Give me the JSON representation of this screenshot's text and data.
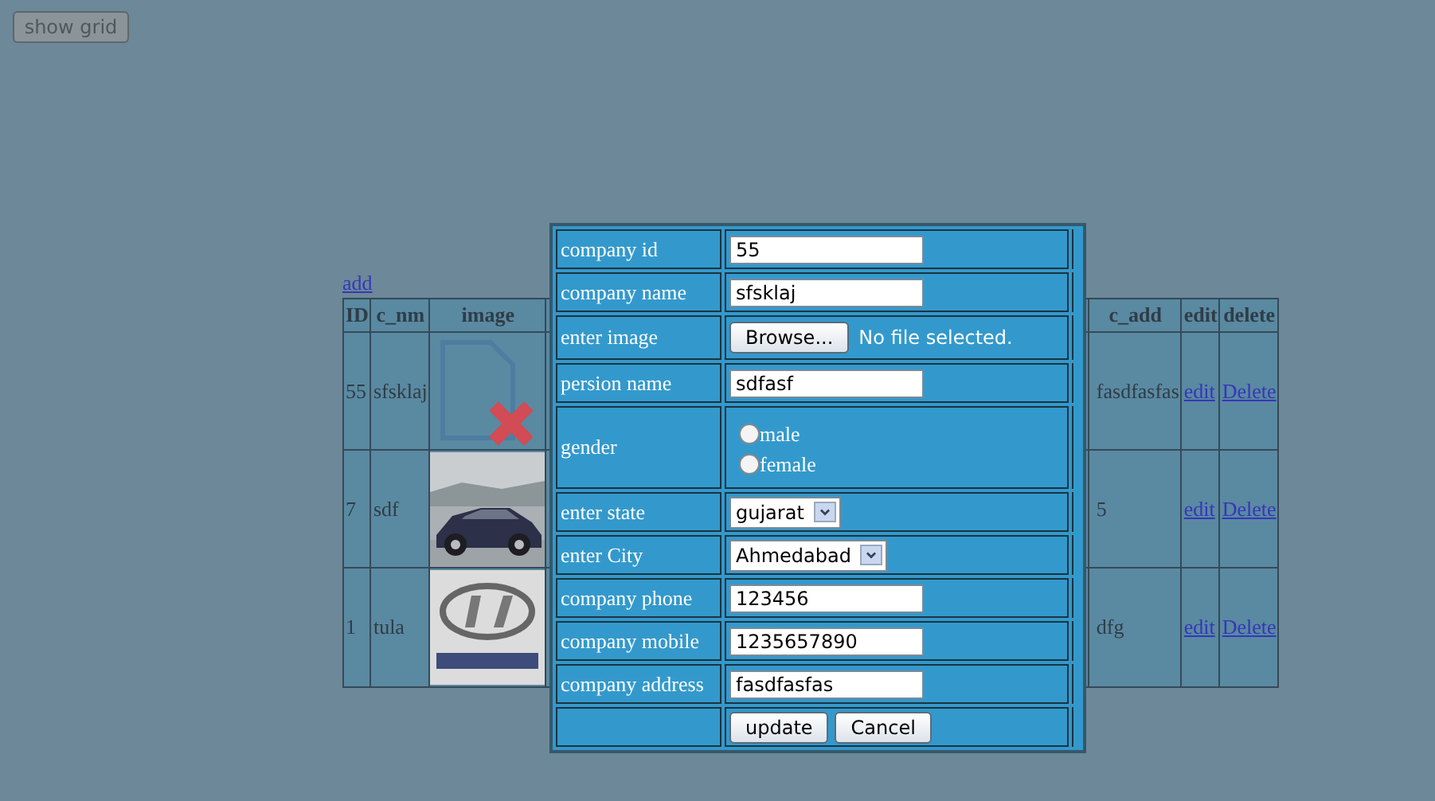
{
  "toolbar": {
    "show_grid_button": "show grid"
  },
  "grid": {
    "add_link": "add",
    "columns": [
      "ID",
      "c_nm",
      "image",
      "c_add",
      "edit",
      "delete"
    ],
    "rows": [
      {
        "id": "55",
        "c_nm": "sfsklaj",
        "image": {
          "kind": "broken"
        },
        "c_add": "fasdfasfas",
        "edit": "edit",
        "delete": "Delete"
      },
      {
        "id": "7",
        "c_nm": "sdf",
        "c_add": "5",
        "edit": "edit",
        "delete": "Delete"
      },
      {
        "id": "1",
        "c_nm": "tula",
        "image": {
          "kind": "logo"
        },
        "c_add": "dfg",
        "edit": "edit",
        "delete": "Delete"
      }
    ]
  },
  "dialog": {
    "fields": [
      {
        "kind": "text",
        "label": "company id",
        "value": "55"
      },
      {
        "kind": "text",
        "label": "company name",
        "value": "sfsklaj"
      },
      {
        "kind": "file",
        "label": "enter image",
        "button": "Browse...",
        "status": "No file selected."
      },
      {
        "kind": "text",
        "label": "persion name",
        "value": "sdfasf"
      },
      {
        "kind": "radio",
        "label": "gender",
        "options": [
          {
            "label": "male",
            "selected": false
          },
          {
            "label": "female",
            "selected": false
          }
        ]
      },
      {
        "kind": "select",
        "label": "enter state",
        "value": "gujarat"
      },
      {
        "kind": "select",
        "label": "enter City",
        "value": "Ahmedabad"
      },
      {
        "kind": "text",
        "label": "company phone",
        "value": "123456"
      },
      {
        "kind": "text",
        "label": "company mobile",
        "value": "1235657890"
      },
      {
        "kind": "text",
        "label": "company address",
        "value": "fasdfasfas"
      },
      {
        "kind": "buttons",
        "buttons": [
          "update",
          "Cancel"
        ]
      }
    ]
  }
}
